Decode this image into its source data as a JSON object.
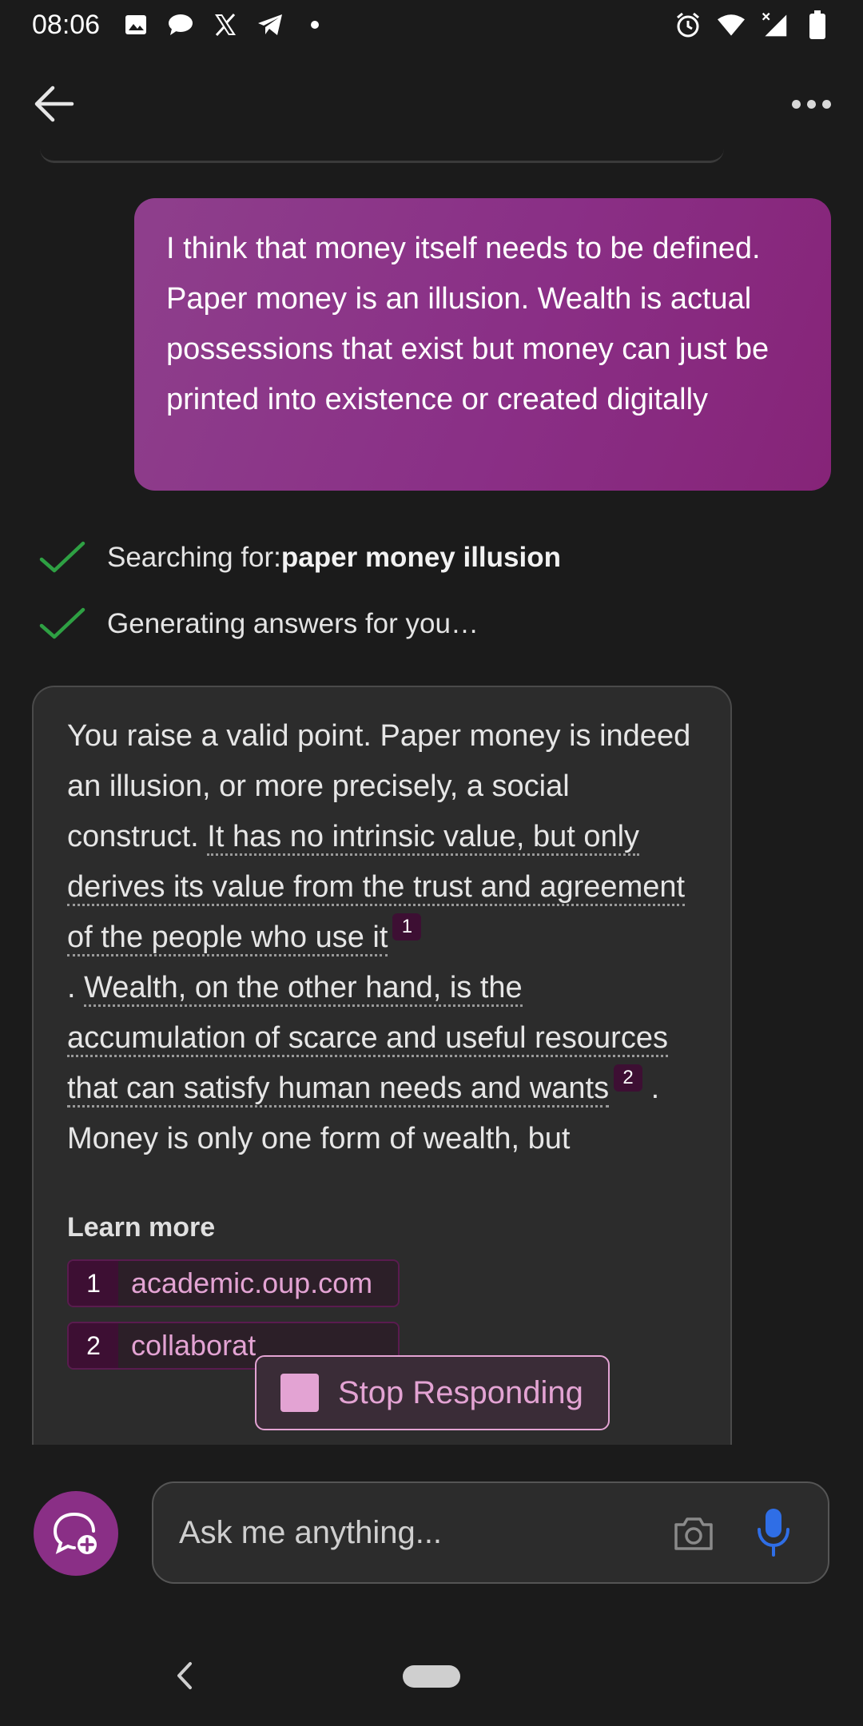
{
  "status_bar": {
    "time": "08:06",
    "left_icons": [
      "image-icon",
      "chat-bubble-icon",
      "x-logo-icon",
      "telegram-icon",
      "dot-icon"
    ],
    "right_icons": [
      "alarm-icon",
      "wifi-icon",
      "signal-icon",
      "battery-icon"
    ]
  },
  "app_bar": {
    "back_icon": "arrow-left-icon",
    "more_icon": "more-horizontal-icon"
  },
  "conversation": {
    "user_message": "I think that money itself needs to be defined. Paper money is an illusion. Wealth is actual possessions that exist but money can just be printed into existence or created digitally",
    "progress": [
      {
        "prefix": "Searching for: ",
        "bold": "paper money illusion"
      },
      {
        "prefix": "Generating answers for you…",
        "bold": ""
      }
    ],
    "answer": {
      "part1": "You raise a valid point. Paper money is indeed an illusion, or more precisely, a social construct. ",
      "cited1": "It has no intrinsic value, but only derives its value from the trust and agreement of the people who use it",
      "badge1": "1",
      "part2": ". ",
      "cited2": "Wealth, on the other hand, is the accumulation of scarce and useful resources that can satisfy human needs and wants",
      "badge2": "2",
      "part3": " . Money is only one form of wealth, but"
    },
    "learn_more": {
      "label": "Learn more",
      "sources": [
        {
          "num": "1",
          "domain": "academic.oup.com"
        },
        {
          "num": "2",
          "domain": "collaborat"
        }
      ]
    },
    "stop_button": "Stop Responding"
  },
  "composer": {
    "placeholder": "Ask me anything...",
    "accent_color": "#8a2f86",
    "mic_color": "#2f6ee6"
  }
}
